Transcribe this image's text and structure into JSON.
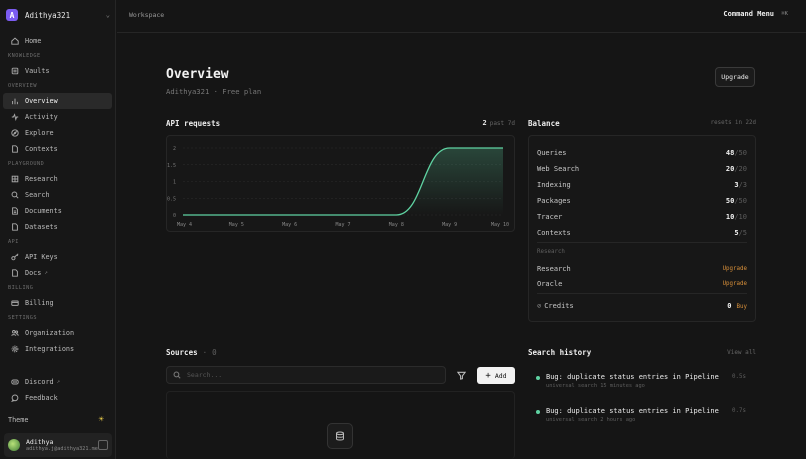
{
  "org": {
    "initial": "A",
    "name": "Adithya321"
  },
  "nav": {
    "home": "Home",
    "knowledge_section": "KNOWLEDGE",
    "vaults": "Vaults",
    "overview_section": "OVERVIEW",
    "overview": "Overview",
    "activity": "Activity",
    "explore": "Explore",
    "contexts": "Contexts",
    "playground_section": "PLAYGROUND",
    "research": "Research",
    "search": "Search",
    "documents": "Documents",
    "datasets": "Datasets",
    "api_section": "API",
    "api_keys": "API Keys",
    "docs": "Docs",
    "billing_section": "BILLING",
    "billing": "Billing",
    "settings_section": "SETTINGS",
    "organization": "Organization",
    "integrations": "Integrations",
    "discord": "Discord",
    "feedback": "Feedback",
    "theme": "Theme"
  },
  "user": {
    "name": "Adithya",
    "email": "adithya.j@adithya321.me"
  },
  "topbar": {
    "breadcrumb": "Workspace",
    "command_menu": "Command Menu",
    "shortcut": "⌘K"
  },
  "page": {
    "title": "Overview",
    "subtitle": "Adithya321 · Free plan",
    "upgrade": "Upgrade"
  },
  "api_requests": {
    "title": "API requests",
    "count": "2",
    "period": "past 7d"
  },
  "chart_data": {
    "type": "area",
    "x": [
      "May 4",
      "May 5",
      "May 6",
      "May 7",
      "May 8",
      "May 9",
      "May 10"
    ],
    "series": [
      {
        "values": [
          0,
          0,
          0,
          0,
          0,
          2,
          2
        ]
      }
    ],
    "yticks": [
      "2",
      "1.5",
      "1",
      "0.5",
      "0"
    ],
    "ylim": [
      0,
      2
    ],
    "accent": "#5fd3a2"
  },
  "balance": {
    "title": "Balance",
    "resets": "resets in 22d",
    "rows": [
      {
        "label": "Queries",
        "used": "48",
        "total": "/50"
      },
      {
        "label": "Web Search",
        "used": "20",
        "total": "/20"
      },
      {
        "label": "Indexing",
        "used": "3",
        "total": "/3"
      },
      {
        "label": "Packages",
        "used": "50",
        "total": "/50"
      },
      {
        "label": "Tracer",
        "used": "10",
        "total": "/10"
      },
      {
        "label": "Contexts",
        "used": "5",
        "total": "/5"
      }
    ],
    "research_section": "Research",
    "research_label": "Research",
    "research_action": "Upgrade",
    "oracle_label": "Oracle",
    "oracle_action": "Upgrade",
    "credits_label": "Credits",
    "credits_value": "0",
    "credits_action": "Buy"
  },
  "sources": {
    "title": "Sources",
    "count": "0",
    "search_placeholder": "Search...",
    "add": "Add"
  },
  "history": {
    "title": "Search history",
    "view_all": "View all",
    "items": [
      {
        "query": "Bug: duplicate status entries in Pipeline",
        "meta": "universal search 15 minutes ago",
        "duration": "0.5s"
      },
      {
        "query": "Bug: duplicate status entries in Pipeline",
        "meta": "universal search 2 hours ago",
        "duration": "0.7s"
      }
    ]
  }
}
